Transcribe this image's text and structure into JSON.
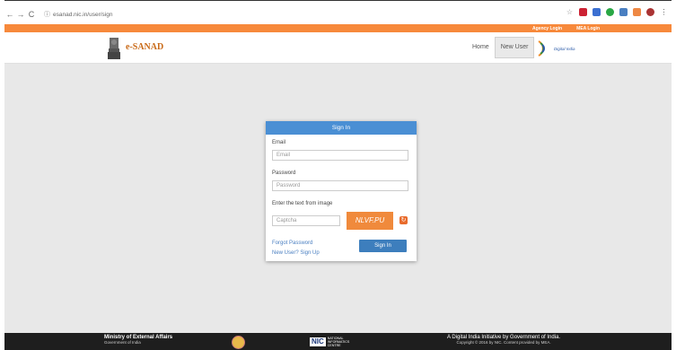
{
  "browser": {
    "url": "esanad.nic.in/user/sign",
    "back": "←",
    "forward": "→",
    "reload": "C"
  },
  "topbar": {
    "agency_login": "Agency Login",
    "mea_login": "MEA Login"
  },
  "header": {
    "brand": "e-SANAD",
    "menu": [
      {
        "label": "Home",
        "active": false
      },
      {
        "label": "New User",
        "active": true
      }
    ],
    "digital_india": "Digital India"
  },
  "signin": {
    "title": "Sign In",
    "email_label": "Email",
    "email_placeholder": "Email",
    "password_label": "Password",
    "password_placeholder": "Password",
    "captcha_label": "Enter the text from image",
    "captcha_placeholder": "Captcha",
    "captcha_text": "NLVF.PU",
    "forgot_password": "Forgot Password",
    "new_user": "New User? Sign Up",
    "signin_button": "Sign In"
  },
  "footer": {
    "ministry": "Ministry of External Affairs",
    "government": "Government of India",
    "nic_logo": "NIC",
    "nic_text": "NATIONAL INFORMATICS CENTRE",
    "initiative": "A Digital India Initiative by Government of India.",
    "copyright": "Copyright © 2016 by NIC. Content provided by MEA."
  },
  "colors": {
    "orange": "#f7893b",
    "primary": "#4a8fd4",
    "footer": "#1e1e1e"
  }
}
